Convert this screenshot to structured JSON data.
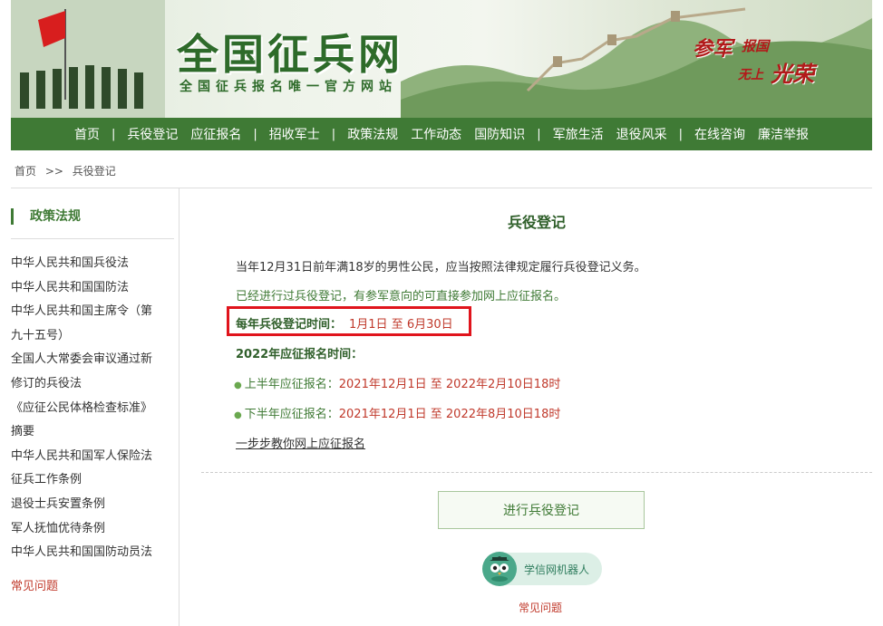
{
  "header": {
    "site_title": "全国征兵网",
    "site_subtitle": "全国征兵报名唯一官方网站",
    "slogan_a": "参军",
    "slogan_b": "报国",
    "slogan_c": "无上",
    "slogan_d": "光荣"
  },
  "nav": {
    "items": [
      {
        "label": "首页"
      },
      {
        "label": "兵役登记"
      },
      {
        "label": "应征报名"
      },
      {
        "label": "招收军士"
      },
      {
        "label": "政策法规"
      },
      {
        "label": "工作动态"
      },
      {
        "label": "国防知识"
      },
      {
        "label": "军旅生活"
      },
      {
        "label": "退役风采"
      },
      {
        "label": "在线咨询"
      },
      {
        "label": "廉洁举报"
      }
    ],
    "separator": "|"
  },
  "breadcrumb": {
    "home": "首页",
    "sep": ">>",
    "current": "兵役登记"
  },
  "sidebar": {
    "heading": "政策法规",
    "items": [
      "中华人民共和国兵役法",
      "中华人民共和国国防法",
      "中华人民共和国主席令（第",
      "九十五号）",
      "全国人大常委会审议通过新",
      "修订的兵役法",
      "《应征公民体格检查标准》",
      "摘要",
      "中华人民共和国军人保险法",
      "征兵工作条例",
      "退役士兵安置条例",
      "军人抚恤优待条例",
      "中华人民共和国国防动员法"
    ],
    "faq": "常见问题"
  },
  "main": {
    "title": "兵役登记",
    "para1": "当年12月31日前年满18岁的男性公民，应当按照法律规定履行兵役登记义务。",
    "para2": "已经进行过兵役登记，有参军意向的可直接参加网上应征报名。",
    "reg_time_label": "每年兵役登记时间：",
    "reg_time_value": "1月1日 至 6月30日",
    "enlist_heading": "2022年应征报名时间：",
    "first_half_label": "上半年应征报名：",
    "first_half_value": "2021年12月1日 至 2022年2月10日18时",
    "second_half_label": "下半年应征报名：",
    "second_half_value": "2021年12月1日 至 2022年8月10日18时",
    "guide_link": "一步步教你网上应征报名",
    "register_button": "进行兵役登记",
    "robot_label": "学信网机器人",
    "faq": "常见问题"
  },
  "colors": {
    "brand_green": "#3f7a35",
    "highlight_red": "#e0141c",
    "accent_red": "#c0392b"
  }
}
